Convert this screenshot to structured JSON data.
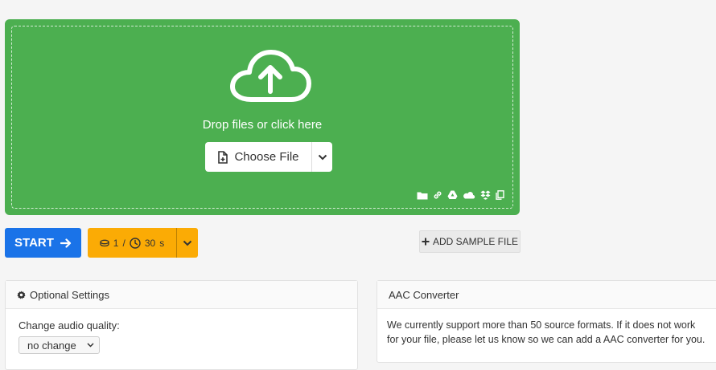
{
  "dropzone": {
    "prompt": "Drop files or click here",
    "choose_label": "Choose File",
    "source_icons": [
      "folder-icon",
      "link-icon",
      "google-drive-icon",
      "onedrive-icon",
      "dropbox-icon",
      "clipboard-icon"
    ]
  },
  "actions": {
    "start_label": "START",
    "credits_count": "1",
    "credits_separator": "/",
    "time_value": "30",
    "time_unit": "s",
    "sample_label": "ADD SAMPLE FILE"
  },
  "settings": {
    "title": "Optional Settings",
    "audio_quality_label": "Change audio quality:",
    "audio_quality_value": "no change"
  },
  "info": {
    "title": "AAC Converter",
    "description": "We currently support more than 50 source formats. If it does not work for your file, please let us know so we can add a AAC converter for you."
  },
  "colors": {
    "dropzone": "#4caf50",
    "start": "#1a73e8",
    "credits": "#fbab05"
  }
}
